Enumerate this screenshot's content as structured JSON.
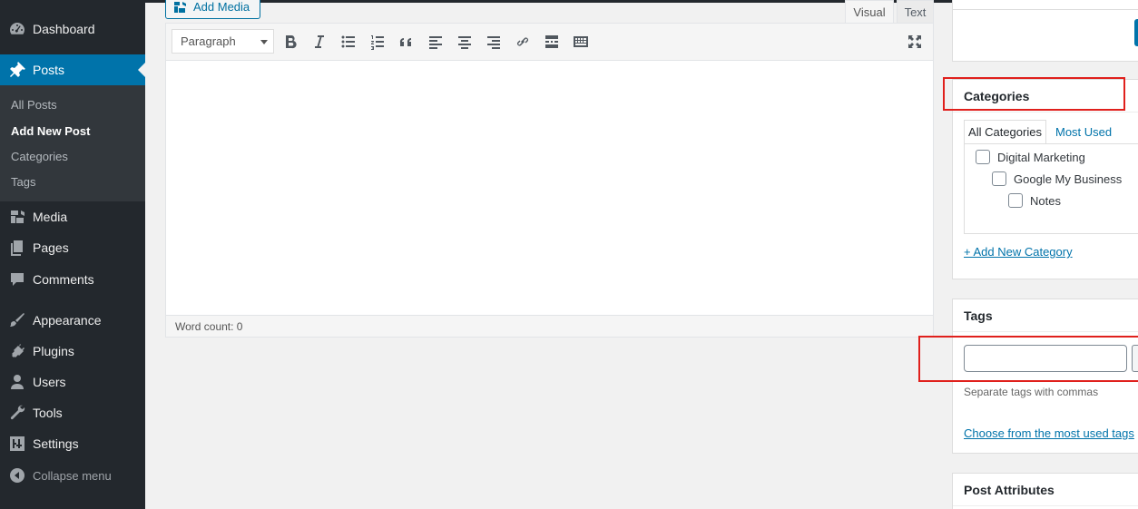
{
  "sidebar": {
    "items": [
      {
        "label": "Dashboard",
        "icon": "dashboard-icon"
      },
      {
        "label": "Posts",
        "icon": "pushpin-icon"
      },
      {
        "label": "Media",
        "icon": "media-icon"
      },
      {
        "label": "Pages",
        "icon": "pages-icon"
      },
      {
        "label": "Comments",
        "icon": "comment-icon"
      },
      {
        "label": "Appearance",
        "icon": "paintbrush-icon"
      },
      {
        "label": "Plugins",
        "icon": "plugin-icon"
      },
      {
        "label": "Users",
        "icon": "user-icon"
      },
      {
        "label": "Tools",
        "icon": "wrench-icon"
      },
      {
        "label": "Settings",
        "icon": "settings-icon"
      }
    ],
    "submenu": [
      "All Posts",
      "Add New Post",
      "Categories",
      "Tags"
    ],
    "collapse_label": "Collapse menu"
  },
  "editor": {
    "add_media_label": "Add Media",
    "tab_visual": "Visual",
    "tab_text": "Text",
    "format_select_value": "Paragraph",
    "toolbar_icons": [
      "bold-icon",
      "italic-icon",
      "bullet-list-icon",
      "numbered-list-icon",
      "blockquote-icon",
      "align-left-icon",
      "align-center-icon",
      "align-right-icon",
      "link-icon",
      "read-more-icon",
      "toolbar-toggle-icon",
      "fullscreen-icon"
    ],
    "word_count": "Word count: 0"
  },
  "categories_panel": {
    "title": "Categories",
    "tab_all": "All Categories",
    "tab_most_used": "Most Used",
    "items": [
      "Digital Marketing",
      "Google My Business",
      "Notes"
    ],
    "add_new_link": "+ Add New Category"
  },
  "tags_panel": {
    "title": "Tags",
    "help_text": "Separate tags with commas",
    "choose_link": "Choose from the most used tags"
  },
  "attributes_panel": {
    "title": "Post Attributes"
  },
  "colors": {
    "sidebar_bg": "#23282d",
    "accent": "#0073aa",
    "highlight": "#e0201c"
  }
}
